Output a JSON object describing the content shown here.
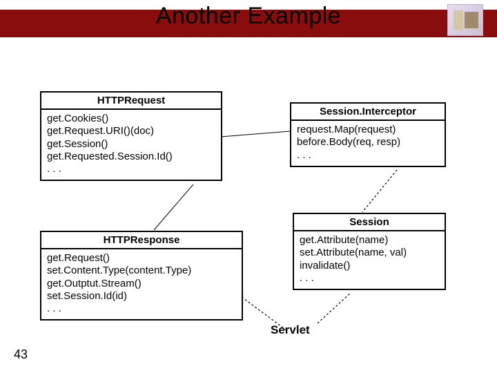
{
  "slide": {
    "title": "Another Example",
    "number": "43"
  },
  "boxes": {
    "request": {
      "title": "HTTPRequest",
      "body": "get.Cookies()\nget.Request.URI()(doc)\nget.Session()\nget.Requested.Session.Id()\n. . ."
    },
    "interceptor": {
      "title": "Session.Interceptor",
      "body": "request.Map(request)\nbefore.Body(req, resp)\n. . ."
    },
    "response": {
      "title": "HTTPResponse",
      "body": "get.Request()\nset.Content.Type(content.Type)\nget.Outptut.Stream()\nset.Session.Id(id)\n. . ."
    },
    "session": {
      "title": "Session",
      "body": "get.Attribute(name)\nset.Attribute(name, val)\ninvalidate()\n. . ."
    }
  },
  "label": {
    "servlet": "Servlet"
  }
}
